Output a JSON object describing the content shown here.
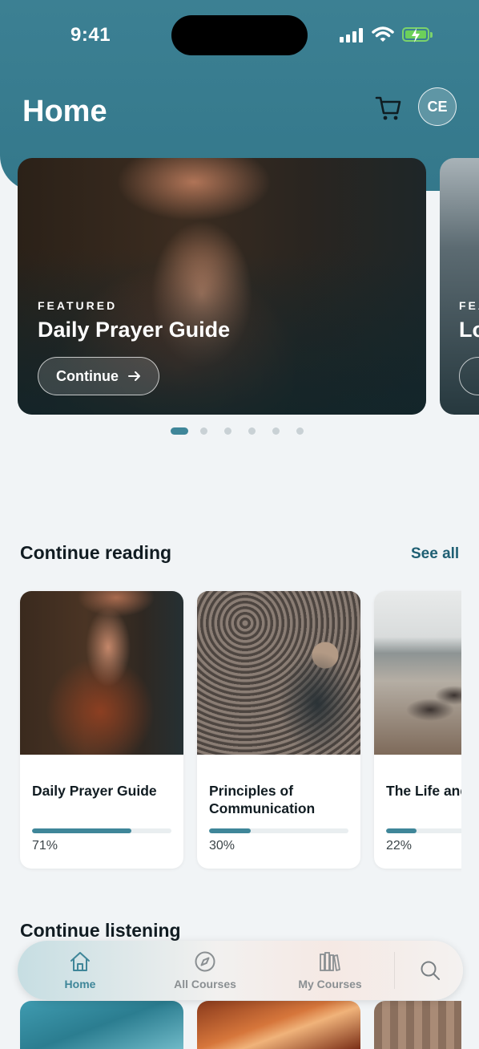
{
  "status_bar": {
    "time": "9:41"
  },
  "header": {
    "title": "Home",
    "avatar_initials": "CE"
  },
  "featured": [
    {
      "eyebrow": "FEATURED",
      "title": "Daily Prayer Guide",
      "button_label": "Continue"
    },
    {
      "eyebrow": "FEA",
      "title": "Lo"
    }
  ],
  "carousel": {
    "page_count": 6,
    "active_index": 0
  },
  "continue_reading": {
    "title": "Continue reading",
    "see_all": "See all",
    "items": [
      {
        "title": "Daily Prayer Guide",
        "progress": 0.71,
        "percent": "71%"
      },
      {
        "title": "Principles of Communication",
        "progress": 0.3,
        "percent": "30%"
      },
      {
        "title": "The Life and Ministry of",
        "progress": 0.22,
        "percent": "22%"
      }
    ]
  },
  "continue_listening": {
    "title": "Continue listening"
  },
  "tabbar": {
    "items": [
      {
        "label": "Home",
        "icon": "home-icon",
        "active": true
      },
      {
        "label": "All Courses",
        "icon": "compass-icon",
        "active": false
      },
      {
        "label": "My Courses",
        "icon": "books-icon",
        "active": false
      },
      {
        "label": "",
        "icon": "search-icon",
        "active": false
      }
    ]
  },
  "colors": {
    "accent": "#3f8699",
    "header_bg": "#3c8093",
    "link": "#1f5f73"
  }
}
